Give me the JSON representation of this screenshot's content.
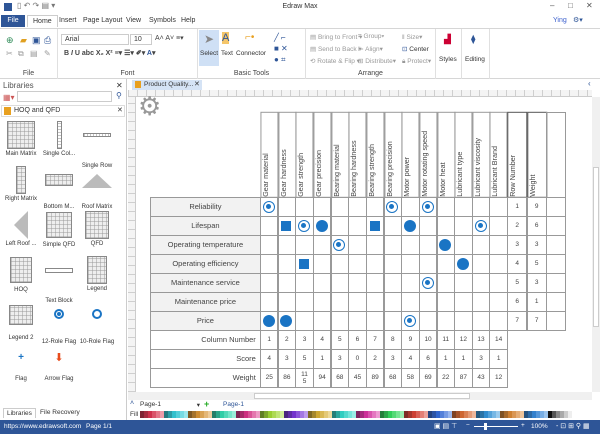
{
  "app": {
    "title": "Edraw Max",
    "user": "Ying"
  },
  "menu": [
    "File",
    "Home",
    "Insert",
    "Page Layout",
    "View",
    "Symbols",
    "Help"
  ],
  "ribbon": {
    "groups": {
      "file": "File",
      "font": "Font",
      "basic": "Basic Tools",
      "arrange": "Arrange"
    },
    "font_name": "Arial",
    "font_size": "10",
    "tools": {
      "select": "Select",
      "text": "Text",
      "connector": "Connector"
    },
    "arrange": {
      "bring_front": "Bring to Front",
      "send_back": "Send to Back",
      "rotate": "Rotate & Flip",
      "group": "Group",
      "align": "Align",
      "distribute": "Distribute",
      "size": "Size",
      "center": "Center",
      "protect": "Protect"
    },
    "styles": "Styles",
    "editing": "Editing"
  },
  "libraries": {
    "title": "Libraries",
    "section": "HOQ and QFD",
    "items": [
      "Main Matrix",
      "Single Col...",
      "Single Row",
      "Right Matrix",
      "Bottom M...",
      "Roof Matrix",
      "Left Roof ...",
      "Simple QFD",
      "QFD",
      "HOQ",
      "Text Block",
      "Legend",
      "Legend 2",
      "12-Role Flag",
      "10-Role Flag",
      "Flag",
      "Arrow Flag"
    ],
    "bottom_tabs": [
      "Libraries",
      "File Recovery"
    ]
  },
  "doc_tab": "Product Quality...",
  "matrix": {
    "columns": [
      "Gear material",
      "Gear hardness",
      "Gear strength",
      "Gear precision",
      "Bearing material",
      "Bearing hardness",
      "Bearing strength",
      "Bearing precision",
      "Motor power",
      "Motor rotating speed",
      "Motor heat",
      "Lubricant type",
      "Lubricant viscosity",
      "Lubricant Brand"
    ],
    "extra_headers": [
      "Row Number",
      "Weight"
    ],
    "rows": [
      {
        "label": "Reliability",
        "row_number": "1",
        "weight": "9",
        "marks": {
          "1": "ring",
          "8": "ring",
          "10": "ring"
        }
      },
      {
        "label": "Lifespan",
        "row_number": "2",
        "weight": "6",
        "marks": {
          "2": "square",
          "3": "ring",
          "4": "dot",
          "7": "square",
          "9": "dot",
          "13": "ring"
        }
      },
      {
        "label": "Operating temperature",
        "row_number": "3",
        "weight": "3",
        "marks": {
          "5": "ring",
          "11": "dot"
        }
      },
      {
        "label": "Operating efficiency",
        "row_number": "4",
        "weight": "5",
        "marks": {
          "3": "square",
          "12": "dot"
        }
      },
      {
        "label": "Maintenance service",
        "row_number": "5",
        "weight": "3",
        "marks": {
          "10": "ring"
        }
      },
      {
        "label": "Maintenance price",
        "row_number": "6",
        "weight": "1",
        "marks": {}
      },
      {
        "label": "Price",
        "row_number": "7",
        "weight": "7",
        "marks": {
          "1": "dot",
          "2": "dot",
          "9": "ring"
        }
      }
    ],
    "footer": [
      {
        "label": "Column Number",
        "values": [
          "1",
          "2",
          "3",
          "4",
          "5",
          "6",
          "7",
          "8",
          "9",
          "10",
          "11",
          "12",
          "13",
          "14"
        ]
      },
      {
        "label": "Score",
        "values": [
          "4",
          "3",
          "5",
          "1",
          "3",
          "0",
          "2",
          "3",
          "4",
          "6",
          "1",
          "1",
          "3",
          "1"
        ]
      },
      {
        "label": "Weight",
        "values": [
          "25",
          "86",
          "115",
          "94",
          "68",
          "45",
          "89",
          "68",
          "58",
          "69",
          "22",
          "87",
          "43",
          "12"
        ]
      }
    ]
  },
  "pages": {
    "selector": "Page-1",
    "tab": "Page-1"
  },
  "fill_label": "Fill",
  "status": {
    "url": "https://www.edrawsoft.com",
    "page": "Page 1/1",
    "zoom": "100%"
  },
  "colors": {
    "accent": "#1a74c4",
    "status_bar": "#2e5597",
    "file_tab": "#2e5597"
  }
}
